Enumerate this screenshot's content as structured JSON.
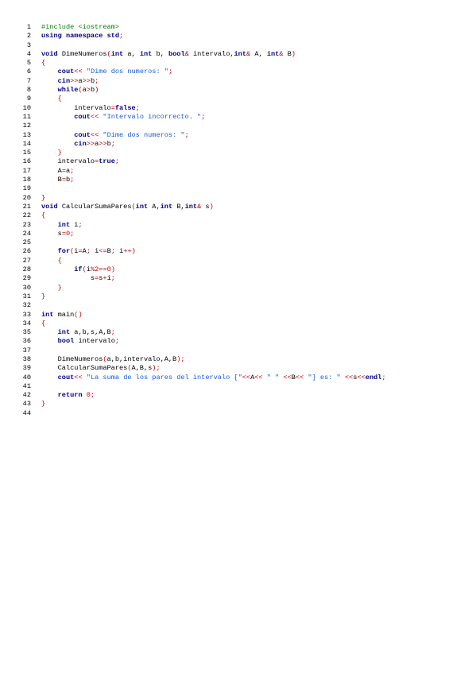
{
  "editor": {
    "colors": {
      "keyword": "#00007f",
      "stream": "#00007f",
      "preprocessor": "#007f00",
      "operator": "#c00000",
      "number": "#c00000",
      "string": "#1a5bd6",
      "identifier": "#000000",
      "line_number": "#000000"
    },
    "lines": [
      {
        "n": "1",
        "tokens": [
          {
            "t": "pp",
            "v": "#include <iostream>"
          }
        ]
      },
      {
        "n": "2",
        "tokens": [
          {
            "t": "kw",
            "v": "using"
          },
          {
            "t": "ws",
            "v": " "
          },
          {
            "t": "kw",
            "v": "namespace"
          },
          {
            "t": "ws",
            "v": " "
          },
          {
            "t": "kw",
            "v": "std"
          },
          {
            "t": "op",
            "v": ";"
          }
        ]
      },
      {
        "n": "3",
        "tokens": []
      },
      {
        "n": "4",
        "tokens": [
          {
            "t": "kw",
            "v": "void"
          },
          {
            "t": "ws",
            "v": " "
          },
          {
            "t": "id",
            "v": "DimeNumeros"
          },
          {
            "t": "op",
            "v": "("
          },
          {
            "t": "kw",
            "v": "int"
          },
          {
            "t": "id",
            "v": " a, "
          },
          {
            "t": "kw",
            "v": "int"
          },
          {
            "t": "id",
            "v": " b, "
          },
          {
            "t": "kw",
            "v": "bool"
          },
          {
            "t": "op",
            "v": "&"
          },
          {
            "t": "id",
            "v": " intervalo,"
          },
          {
            "t": "kw",
            "v": "int"
          },
          {
            "t": "op",
            "v": "&"
          },
          {
            "t": "id",
            "v": " A, "
          },
          {
            "t": "kw",
            "v": "int"
          },
          {
            "t": "op",
            "v": "&"
          },
          {
            "t": "id",
            "v": " B"
          },
          {
            "t": "op",
            "v": ")"
          }
        ]
      },
      {
        "n": "5",
        "tokens": [
          {
            "t": "op",
            "v": "{"
          }
        ]
      },
      {
        "n": "6",
        "tokens": [
          {
            "t": "ws",
            "v": "    "
          },
          {
            "t": "st",
            "v": "cout"
          },
          {
            "t": "op",
            "v": "<<"
          },
          {
            "t": "ws",
            "v": " "
          },
          {
            "t": "str",
            "v": "\"Dime dos numeros: \""
          },
          {
            "t": "op",
            "v": ";"
          }
        ]
      },
      {
        "n": "7",
        "tokens": [
          {
            "t": "ws",
            "v": "    "
          },
          {
            "t": "st",
            "v": "cin"
          },
          {
            "t": "op",
            "v": ">>"
          },
          {
            "t": "id",
            "v": "a"
          },
          {
            "t": "op",
            "v": ">>"
          },
          {
            "t": "id",
            "v": "b"
          },
          {
            "t": "op",
            "v": ";"
          }
        ]
      },
      {
        "n": "8",
        "tokens": [
          {
            "t": "ws",
            "v": "    "
          },
          {
            "t": "kw",
            "v": "while"
          },
          {
            "t": "op",
            "v": "("
          },
          {
            "t": "id",
            "v": "a"
          },
          {
            "t": "op",
            "v": ">"
          },
          {
            "t": "id",
            "v": "b"
          },
          {
            "t": "op",
            "v": ")"
          }
        ]
      },
      {
        "n": "9",
        "tokens": [
          {
            "t": "ws",
            "v": "    "
          },
          {
            "t": "op",
            "v": "{"
          }
        ]
      },
      {
        "n": "10",
        "tokens": [
          {
            "t": "ws",
            "v": "        "
          },
          {
            "t": "id",
            "v": "intervalo"
          },
          {
            "t": "op",
            "v": "="
          },
          {
            "t": "kw",
            "v": "false"
          },
          {
            "t": "op",
            "v": ";"
          }
        ]
      },
      {
        "n": "11",
        "tokens": [
          {
            "t": "ws",
            "v": "        "
          },
          {
            "t": "st",
            "v": "cout"
          },
          {
            "t": "op",
            "v": "<<"
          },
          {
            "t": "ws",
            "v": " "
          },
          {
            "t": "str",
            "v": "\"Intervalo incorrecto. \""
          },
          {
            "t": "op",
            "v": ";"
          }
        ]
      },
      {
        "n": "12",
        "tokens": []
      },
      {
        "n": "13",
        "tokens": [
          {
            "t": "ws",
            "v": "        "
          },
          {
            "t": "st",
            "v": "cout"
          },
          {
            "t": "op",
            "v": "<<"
          },
          {
            "t": "ws",
            "v": " "
          },
          {
            "t": "str",
            "v": "\"Dime dos numeros: \""
          },
          {
            "t": "op",
            "v": ";"
          }
        ]
      },
      {
        "n": "14",
        "tokens": [
          {
            "t": "ws",
            "v": "        "
          },
          {
            "t": "st",
            "v": "cin"
          },
          {
            "t": "op",
            "v": ">>"
          },
          {
            "t": "id",
            "v": "a"
          },
          {
            "t": "op",
            "v": ">>"
          },
          {
            "t": "id",
            "v": "b"
          },
          {
            "t": "op",
            "v": ";"
          }
        ]
      },
      {
        "n": "15",
        "tokens": [
          {
            "t": "ws",
            "v": "    "
          },
          {
            "t": "op",
            "v": "}"
          }
        ]
      },
      {
        "n": "16",
        "tokens": [
          {
            "t": "ws",
            "v": "    "
          },
          {
            "t": "id",
            "v": "intervalo"
          },
          {
            "t": "op",
            "v": "="
          },
          {
            "t": "kw",
            "v": "true"
          },
          {
            "t": "op",
            "v": ";"
          }
        ]
      },
      {
        "n": "17",
        "tokens": [
          {
            "t": "ws",
            "v": "    "
          },
          {
            "t": "id",
            "v": "A"
          },
          {
            "t": "op",
            "v": "="
          },
          {
            "t": "id",
            "v": "a"
          },
          {
            "t": "op",
            "v": ";"
          }
        ]
      },
      {
        "n": "18",
        "tokens": [
          {
            "t": "ws",
            "v": "    "
          },
          {
            "t": "id",
            "v": "B"
          },
          {
            "t": "op",
            "v": "="
          },
          {
            "t": "id",
            "v": "b"
          },
          {
            "t": "op",
            "v": ";"
          }
        ]
      },
      {
        "n": "19",
        "tokens": []
      },
      {
        "n": "20",
        "tokens": [
          {
            "t": "op",
            "v": "}"
          }
        ]
      },
      {
        "n": "21",
        "tokens": [
          {
            "t": "kw",
            "v": "void"
          },
          {
            "t": "ws",
            "v": " "
          },
          {
            "t": "id",
            "v": "CalcularSumaPares"
          },
          {
            "t": "op",
            "v": "("
          },
          {
            "t": "kw",
            "v": "int"
          },
          {
            "t": "id",
            "v": " A,"
          },
          {
            "t": "kw",
            "v": "int"
          },
          {
            "t": "id",
            "v": " B,"
          },
          {
            "t": "kw",
            "v": "int"
          },
          {
            "t": "op",
            "v": "&"
          },
          {
            "t": "id",
            "v": " s"
          },
          {
            "t": "op",
            "v": ")"
          }
        ]
      },
      {
        "n": "22",
        "tokens": [
          {
            "t": "op",
            "v": "{"
          }
        ]
      },
      {
        "n": "23",
        "tokens": [
          {
            "t": "ws",
            "v": "    "
          },
          {
            "t": "kw",
            "v": "int"
          },
          {
            "t": "id",
            "v": " i"
          },
          {
            "t": "op",
            "v": ";"
          }
        ]
      },
      {
        "n": "24",
        "tokens": [
          {
            "t": "ws",
            "v": "    "
          },
          {
            "t": "id",
            "v": "s"
          },
          {
            "t": "op",
            "v": "="
          },
          {
            "t": "num",
            "v": "0"
          },
          {
            "t": "op",
            "v": ";"
          }
        ]
      },
      {
        "n": "25",
        "tokens": []
      },
      {
        "n": "26",
        "tokens": [
          {
            "t": "ws",
            "v": "    "
          },
          {
            "t": "kw",
            "v": "for"
          },
          {
            "t": "op",
            "v": "("
          },
          {
            "t": "id",
            "v": "i"
          },
          {
            "t": "op",
            "v": "="
          },
          {
            "t": "id",
            "v": "A"
          },
          {
            "t": "op",
            "v": ";"
          },
          {
            "t": "id",
            "v": " i"
          },
          {
            "t": "op",
            "v": "<="
          },
          {
            "t": "id",
            "v": "B"
          },
          {
            "t": "op",
            "v": ";"
          },
          {
            "t": "id",
            "v": " i"
          },
          {
            "t": "op",
            "v": "++)"
          }
        ]
      },
      {
        "n": "27",
        "tokens": [
          {
            "t": "ws",
            "v": "    "
          },
          {
            "t": "op",
            "v": "{"
          }
        ]
      },
      {
        "n": "28",
        "tokens": [
          {
            "t": "ws",
            "v": "        "
          },
          {
            "t": "kw",
            "v": "if"
          },
          {
            "t": "op",
            "v": "("
          },
          {
            "t": "id",
            "v": "i"
          },
          {
            "t": "op",
            "v": "%"
          },
          {
            "t": "num",
            "v": "2"
          },
          {
            "t": "op",
            "v": "=="
          },
          {
            "t": "num",
            "v": "0"
          },
          {
            "t": "op",
            "v": ")"
          }
        ]
      },
      {
        "n": "29",
        "tokens": [
          {
            "t": "ws",
            "v": "            "
          },
          {
            "t": "id",
            "v": "s"
          },
          {
            "t": "op",
            "v": "="
          },
          {
            "t": "id",
            "v": "s"
          },
          {
            "t": "op",
            "v": "+"
          },
          {
            "t": "id",
            "v": "i"
          },
          {
            "t": "op",
            "v": ";"
          }
        ]
      },
      {
        "n": "30",
        "tokens": [
          {
            "t": "ws",
            "v": "    "
          },
          {
            "t": "op",
            "v": "}"
          }
        ]
      },
      {
        "n": "31",
        "tokens": [
          {
            "t": "op",
            "v": "}"
          }
        ]
      },
      {
        "n": "32",
        "tokens": []
      },
      {
        "n": "33",
        "tokens": [
          {
            "t": "kw",
            "v": "int"
          },
          {
            "t": "id",
            "v": " main"
          },
          {
            "t": "op",
            "v": "()"
          }
        ]
      },
      {
        "n": "34",
        "tokens": [
          {
            "t": "op",
            "v": "{"
          }
        ]
      },
      {
        "n": "35",
        "tokens": [
          {
            "t": "ws",
            "v": "    "
          },
          {
            "t": "kw",
            "v": "int"
          },
          {
            "t": "id",
            "v": " a,b,s,A,B"
          },
          {
            "t": "op",
            "v": ";"
          }
        ]
      },
      {
        "n": "36",
        "tokens": [
          {
            "t": "ws",
            "v": "    "
          },
          {
            "t": "kw",
            "v": "bool"
          },
          {
            "t": "id",
            "v": " intervalo"
          },
          {
            "t": "op",
            "v": ";"
          }
        ]
      },
      {
        "n": "37",
        "tokens": []
      },
      {
        "n": "38",
        "tokens": [
          {
            "t": "ws",
            "v": "    "
          },
          {
            "t": "id",
            "v": "DimeNumeros"
          },
          {
            "t": "op",
            "v": "("
          },
          {
            "t": "id",
            "v": "a,b,intervalo,A,B"
          },
          {
            "t": "op",
            "v": ");"
          }
        ]
      },
      {
        "n": "39",
        "tokens": [
          {
            "t": "ws",
            "v": "    "
          },
          {
            "t": "id",
            "v": "CalcularSumaPares"
          },
          {
            "t": "op",
            "v": "("
          },
          {
            "t": "id",
            "v": "A,B,s"
          },
          {
            "t": "op",
            "v": ");"
          }
        ]
      },
      {
        "n": "40",
        "tokens": [
          {
            "t": "ws",
            "v": "    "
          },
          {
            "t": "st",
            "v": "cout"
          },
          {
            "t": "op",
            "v": "<<"
          },
          {
            "t": "ws",
            "v": " "
          },
          {
            "t": "str",
            "v": "\"La suma de los pares del intervalo [\""
          },
          {
            "t": "op",
            "v": "<<"
          },
          {
            "t": "id",
            "v": "A"
          },
          {
            "t": "op",
            "v": "<<"
          },
          {
            "t": "ws",
            "v": " "
          },
          {
            "t": "str",
            "v": "\" \""
          },
          {
            "t": "ws",
            "v": " "
          },
          {
            "t": "op",
            "v": "<<"
          },
          {
            "t": "id",
            "v": "B"
          },
          {
            "t": "op",
            "v": "<<"
          },
          {
            "t": "ws",
            "v": " "
          },
          {
            "t": "str",
            "v": "\"] es: \""
          },
          {
            "t": "ws",
            "v": " "
          },
          {
            "t": "op",
            "v": "<<"
          },
          {
            "t": "id",
            "v": "s"
          },
          {
            "t": "op",
            "v": "<<"
          },
          {
            "t": "kw",
            "v": "endl"
          },
          {
            "t": "op",
            "v": ";"
          }
        ]
      },
      {
        "n": "41",
        "tokens": []
      },
      {
        "n": "42",
        "tokens": [
          {
            "t": "ws",
            "v": "    "
          },
          {
            "t": "kw",
            "v": "return"
          },
          {
            "t": "ws",
            "v": " "
          },
          {
            "t": "num",
            "v": "0"
          },
          {
            "t": "op",
            "v": ";"
          }
        ]
      },
      {
        "n": "43",
        "tokens": [
          {
            "t": "op",
            "v": "}"
          }
        ]
      },
      {
        "n": "44",
        "tokens": []
      }
    ]
  }
}
